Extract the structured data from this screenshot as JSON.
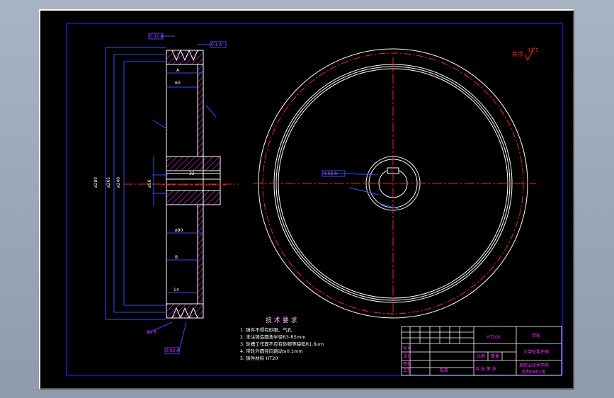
{
  "drawing": {
    "roughness_note": "其余",
    "roughness_value": "12.5",
    "tech_req": {
      "title": "技 术 要 求",
      "items": [
        "1. 铸件不得有砂眼、气孔",
        "2. 未注铸造圆角半径R3-R5mm",
        "3. 轮槽工作面不应有砂眼等缺陷R1.6um",
        "4. 带轮外圆径向跳动≤0.1mm",
        "5. 铸件材料 HT20"
      ]
    },
    "title_block": {
      "material": "HT200",
      "part_name": "带轮",
      "drawing_name": "大带轮零件图",
      "school": "某职业技术学院",
      "class": "机制0801班",
      "label_design": "设计",
      "label_check": "审核",
      "label_process": "工艺",
      "label_approve": "批准",
      "label_scale": "比例",
      "label_weight": "重量",
      "label_sheet": "共 张 第 张",
      "label_mark": "标记"
    },
    "dims": {
      "top_tol": "0.02 A",
      "top_right": "0.1 A",
      "hub_key": "0.02 A",
      "bottom_left": "0.02 A",
      "bottom_right": "R1.6"
    }
  }
}
